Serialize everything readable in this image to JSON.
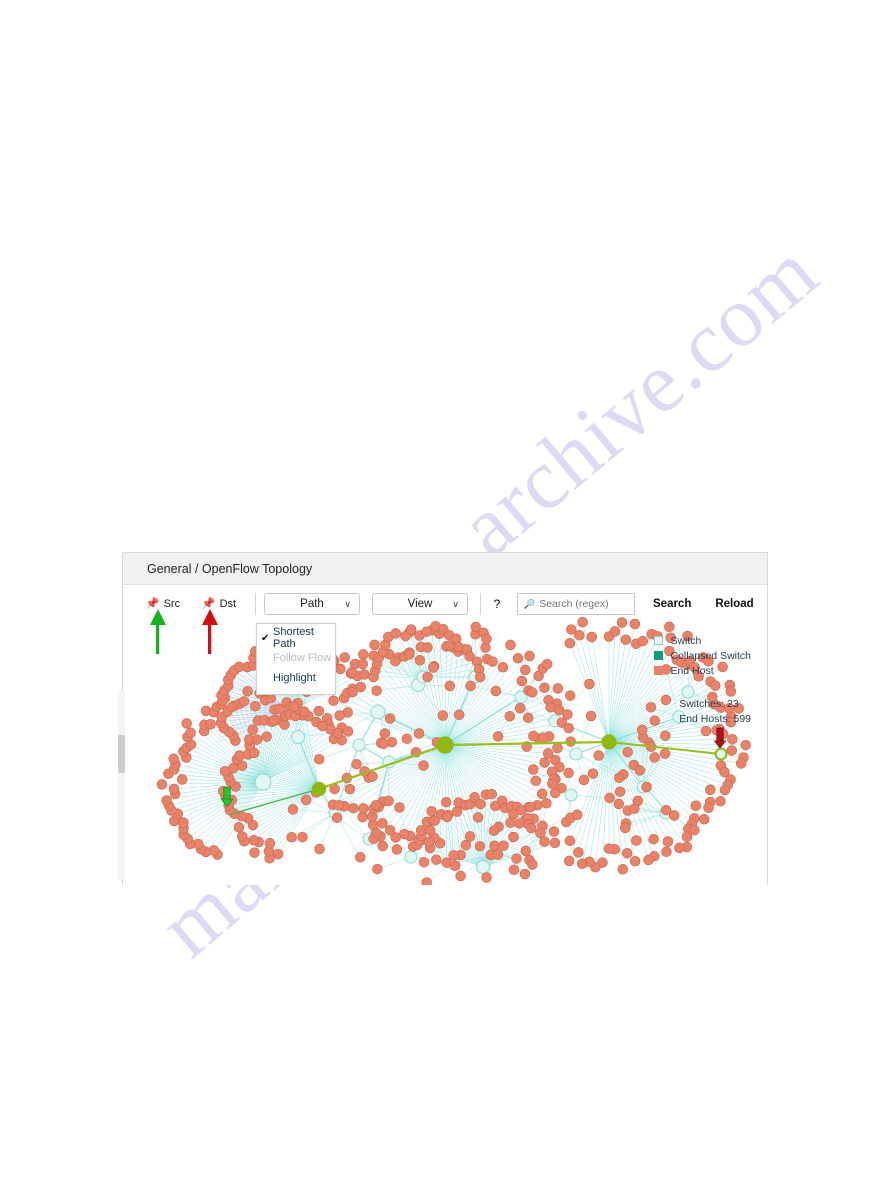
{
  "watermark": {
    "line1": "archive.com",
    "line2": "manual"
  },
  "panel": {
    "title": "General / OpenFlow Topology"
  },
  "toolbar": {
    "src": {
      "label": "Src",
      "pin_icon": "pin-icon",
      "arrow_color": "#16b21c"
    },
    "dst": {
      "label": "Dst",
      "pin_icon": "pin-icon",
      "arrow_color": "#d40d12"
    },
    "path_select": {
      "label": "Path",
      "caret": "∨"
    },
    "view_select": {
      "label": "View",
      "caret": "∨"
    },
    "help": "?",
    "search": {
      "placeholder": "Search (regex)",
      "value": "",
      "icon": "magnifier-icon"
    },
    "search_button": "Search",
    "reload_button": "Reload"
  },
  "path_menu": {
    "items": [
      {
        "label": "Shortest Path",
        "checked": true,
        "check_glyph": "✔",
        "disabled": false
      },
      {
        "label": "Follow Flow",
        "checked": false,
        "check_glyph": "",
        "disabled": true
      },
      {
        "label": "Highlight",
        "checked": false,
        "check_glyph": "",
        "disabled": false
      }
    ]
  },
  "legend": {
    "items": [
      {
        "label": "Switch",
        "color": "#e4f7f5"
      },
      {
        "label": "Collapsed Switch",
        "color": "#0aa07f"
      },
      {
        "label": "End Host",
        "color": "#e8836a"
      }
    ]
  },
  "stats": {
    "switches": "Switches: 23",
    "end_hosts": "End Hosts: 599"
  },
  "topology": {
    "colors": {
      "edge": "#5fd4d0",
      "host": "#e8836a",
      "host_stroke": "#cf6a52",
      "switch_fill": "#e0f7f4",
      "switch_stroke": "#8fd9d2",
      "path_node": "#8fb811",
      "path_edge": "#9cbe1c",
      "src_marker": "#16b21c",
      "dst_marker": "#9e1114"
    },
    "markers": {
      "src": "src-arrow-marker",
      "dst": "dst-arrow-marker"
    }
  }
}
